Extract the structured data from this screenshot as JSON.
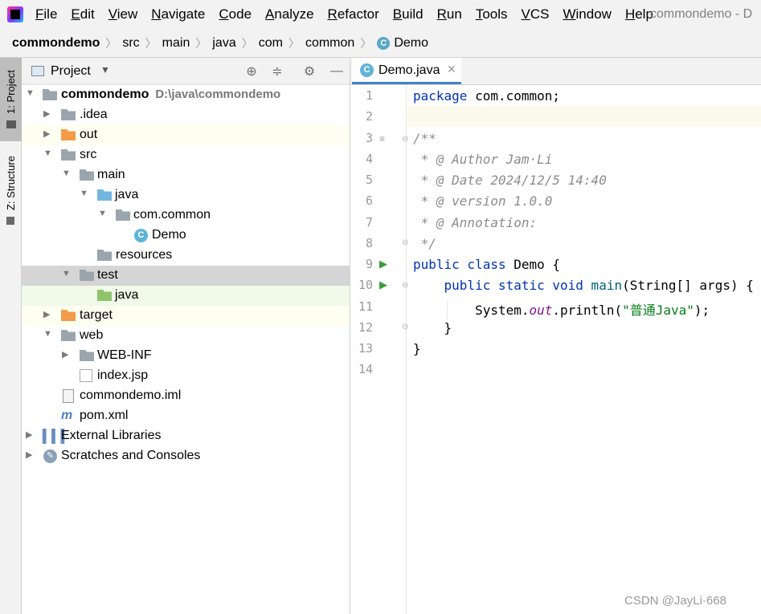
{
  "menubar": {
    "items": [
      "File",
      "Edit",
      "View",
      "Navigate",
      "Code",
      "Analyze",
      "Refactor",
      "Build",
      "Run",
      "Tools",
      "VCS",
      "Window",
      "Help"
    ],
    "window_title": "commondemo - D"
  },
  "breadcrumb": [
    "commondemo",
    "src",
    "main",
    "java",
    "com",
    "common",
    "Demo"
  ],
  "sidestrip": {
    "project_tab": "1: Project",
    "structure_tab": "Z: Structure"
  },
  "project_panel": {
    "title": "Project",
    "tree": [
      {
        "label": "commondemo",
        "path": "D:\\java\\commondemo"
      },
      {
        "label": ".idea"
      },
      {
        "label": "out"
      },
      {
        "label": "src"
      },
      {
        "label": "main"
      },
      {
        "label": "java"
      },
      {
        "label": "com.common"
      },
      {
        "label": "Demo"
      },
      {
        "label": "resources"
      },
      {
        "label": "test"
      },
      {
        "label": "java"
      },
      {
        "label": "target"
      },
      {
        "label": "web"
      },
      {
        "label": "WEB-INF"
      },
      {
        "label": "index.jsp"
      },
      {
        "label": "commondemo.iml"
      },
      {
        "label": "pom.xml"
      },
      {
        "label": "External Libraries"
      },
      {
        "label": "Scratches and Consoles"
      }
    ]
  },
  "editor": {
    "tab_label": "Demo.java",
    "line_numbers": [
      "1",
      "2",
      "3",
      "4",
      "5",
      "6",
      "7",
      "8",
      "9",
      "10",
      "11",
      "12",
      "13",
      "14"
    ],
    "code": {
      "l1_kw": "package",
      "l1_rest": " com.common;",
      "l3": "/**",
      "l4": " * @ Author Jam·Li",
      "l5": " * @ Date 2024/12/5 14:40",
      "l6": " * @ version 1.0.0",
      "l7": " * @ Annotation:",
      "l8": " */",
      "l9_kw": "public class",
      "l9_rest": " Demo {",
      "l10_kw": "    public static void",
      "l10_fn": " main",
      "l10_rest": "(String[] args) {",
      "l11_a": "        System.",
      "l11_fld": "out",
      "l11_b": ".println(",
      "l11_str": "\"普通Java\"",
      "l11_c": ");",
      "l12": "    }",
      "l13": "}"
    }
  },
  "watermark": "CSDN @JayLi·668"
}
